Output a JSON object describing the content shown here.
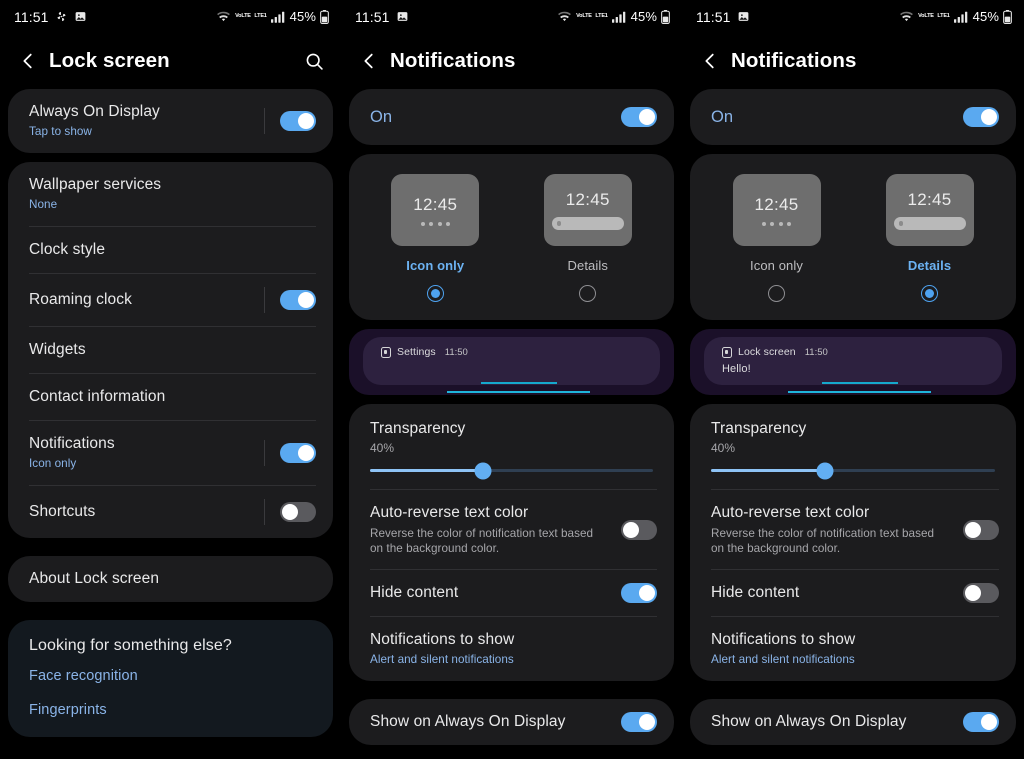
{
  "statusbar": {
    "time": "11:51",
    "battery_percent": "45%",
    "icons": [
      "photos-icon",
      "image-icon",
      "wifi-icon",
      "volte-icon",
      "signal-icon",
      "battery-icon"
    ],
    "volte_top": "VoLTE",
    "volte_bottom": "LTE1"
  },
  "colors": {
    "accent_blue": "#5aa9f0",
    "link_blue": "#8ab4e8",
    "selected_blue": "#6cb2f2",
    "card_bg": "#1c1c1e",
    "suggest_bg": "#13191f",
    "page_bg": "#000000",
    "notif_preview_bg": "#1b1029",
    "cyan_line": "#1fb4db"
  },
  "panels": [
    {
      "id": "lock-screen",
      "header": {
        "title": "Lock screen",
        "back_icon": "back-chevron-icon",
        "search_icon": "search-icon"
      },
      "aod": {
        "title": "Always On Display",
        "subtitle": "Tap to show",
        "toggle": "on"
      },
      "items": [
        {
          "title": "Wallpaper services",
          "subtitle": "None",
          "toggle": null
        },
        {
          "title": "Clock style",
          "subtitle": null,
          "toggle": null
        },
        {
          "title": "Roaming clock",
          "subtitle": null,
          "toggle": "on"
        },
        {
          "title": "Widgets",
          "subtitle": null,
          "toggle": null
        },
        {
          "title": "Contact information",
          "subtitle": null,
          "toggle": null
        },
        {
          "title": "Notifications",
          "subtitle": "Icon only",
          "toggle": "on"
        },
        {
          "title": "Shortcuts",
          "subtitle": null,
          "toggle": "off"
        }
      ],
      "about": {
        "title": "About Lock screen"
      },
      "suggestions": {
        "title": "Looking for something else?",
        "links": [
          "Face recognition",
          "Fingerprints"
        ]
      }
    },
    {
      "id": "notifications-icon-only",
      "header": {
        "title": "Notifications",
        "back_icon": "back-chevron-icon"
      },
      "master": {
        "label": "On",
        "toggle": "on"
      },
      "chooser": [
        {
          "label": "Icon only",
          "thumb_time": "12:45",
          "style": "dots",
          "selected": true
        },
        {
          "label": "Details",
          "thumb_time": "12:45",
          "style": "bar",
          "selected": false
        }
      ],
      "preview": {
        "app_icon": "settings-app-icon",
        "app": "Settings",
        "time": "11:50",
        "body": null
      },
      "transparency": {
        "title": "Transparency",
        "value_label": "40%",
        "percent": 40
      },
      "options": [
        {
          "title": "Auto-reverse text color",
          "desc": "Reverse the color of notification text based on the background color.",
          "toggle": "off"
        },
        {
          "title": "Hide content",
          "desc": null,
          "toggle": "on"
        },
        {
          "title": "Notifications to show",
          "subtitle": "Alert and silent notifications",
          "toggle": null
        }
      ],
      "aod_row": {
        "title": "Show on Always On Display",
        "toggle": "on"
      }
    },
    {
      "id": "notifications-details",
      "header": {
        "title": "Notifications",
        "back_icon": "back-chevron-icon"
      },
      "master": {
        "label": "On",
        "toggle": "on"
      },
      "chooser": [
        {
          "label": "Icon only",
          "thumb_time": "12:45",
          "style": "dots",
          "selected": false
        },
        {
          "label": "Details",
          "thumb_time": "12:45",
          "style": "bar",
          "selected": true
        }
      ],
      "preview": {
        "app_icon": "lockscreen-app-icon",
        "app": "Lock screen",
        "time": "11:50",
        "body": "Hello!"
      },
      "transparency": {
        "title": "Transparency",
        "value_label": "40%",
        "percent": 40
      },
      "options": [
        {
          "title": "Auto-reverse text color",
          "desc": "Reverse the color of notification text based on the background color.",
          "toggle": "off"
        },
        {
          "title": "Hide content",
          "desc": null,
          "toggle": "off"
        },
        {
          "title": "Notifications to show",
          "subtitle": "Alert and silent notifications",
          "toggle": null
        }
      ],
      "aod_row": {
        "title": "Show on Always On Display",
        "toggle": "on"
      }
    }
  ]
}
